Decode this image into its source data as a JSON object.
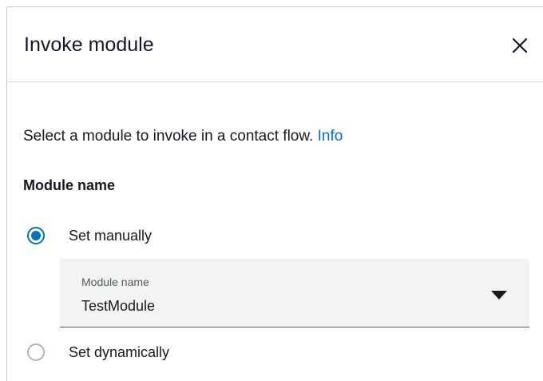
{
  "panel": {
    "title": "Invoke module",
    "close_icon": "close-icon"
  },
  "content": {
    "description": "Select a module to invoke in a contact flow.",
    "info_link": "Info",
    "section_label": "Module name",
    "options": [
      {
        "label": "Set manually",
        "selected": true
      },
      {
        "label": "Set dynamically",
        "selected": false
      }
    ],
    "select": {
      "label": "Module name",
      "value": "TestModule",
      "caret_icon": "caret-down-icon"
    }
  },
  "colors": {
    "accent": "#0073bb",
    "text": "#16191f",
    "select_background": "#f2f3f3"
  }
}
